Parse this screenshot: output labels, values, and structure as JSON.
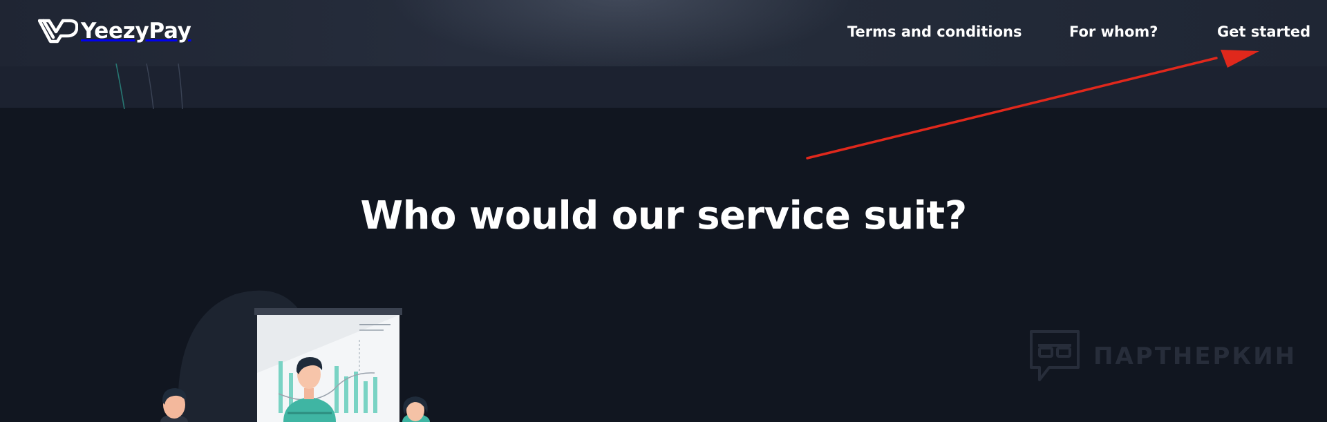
{
  "brand": {
    "name": "YeezyPay",
    "logo_icon": "yp-monogram-icon"
  },
  "nav": {
    "items": [
      {
        "label": "Terms and conditions"
      },
      {
        "label": "For whom?"
      },
      {
        "label": "Get started"
      }
    ]
  },
  "hero": {
    "title": "Who would our service suit?"
  },
  "annotation": {
    "type": "red-arrow",
    "color": "#e0281c",
    "points_to": "Get started"
  },
  "watermark": {
    "text": "ПАРТНЕРКИН",
    "icon": "speech-bubble-mask-icon"
  },
  "colors": {
    "background": "#111620",
    "header": "#252c3a",
    "accent": "#5cc9b8"
  }
}
